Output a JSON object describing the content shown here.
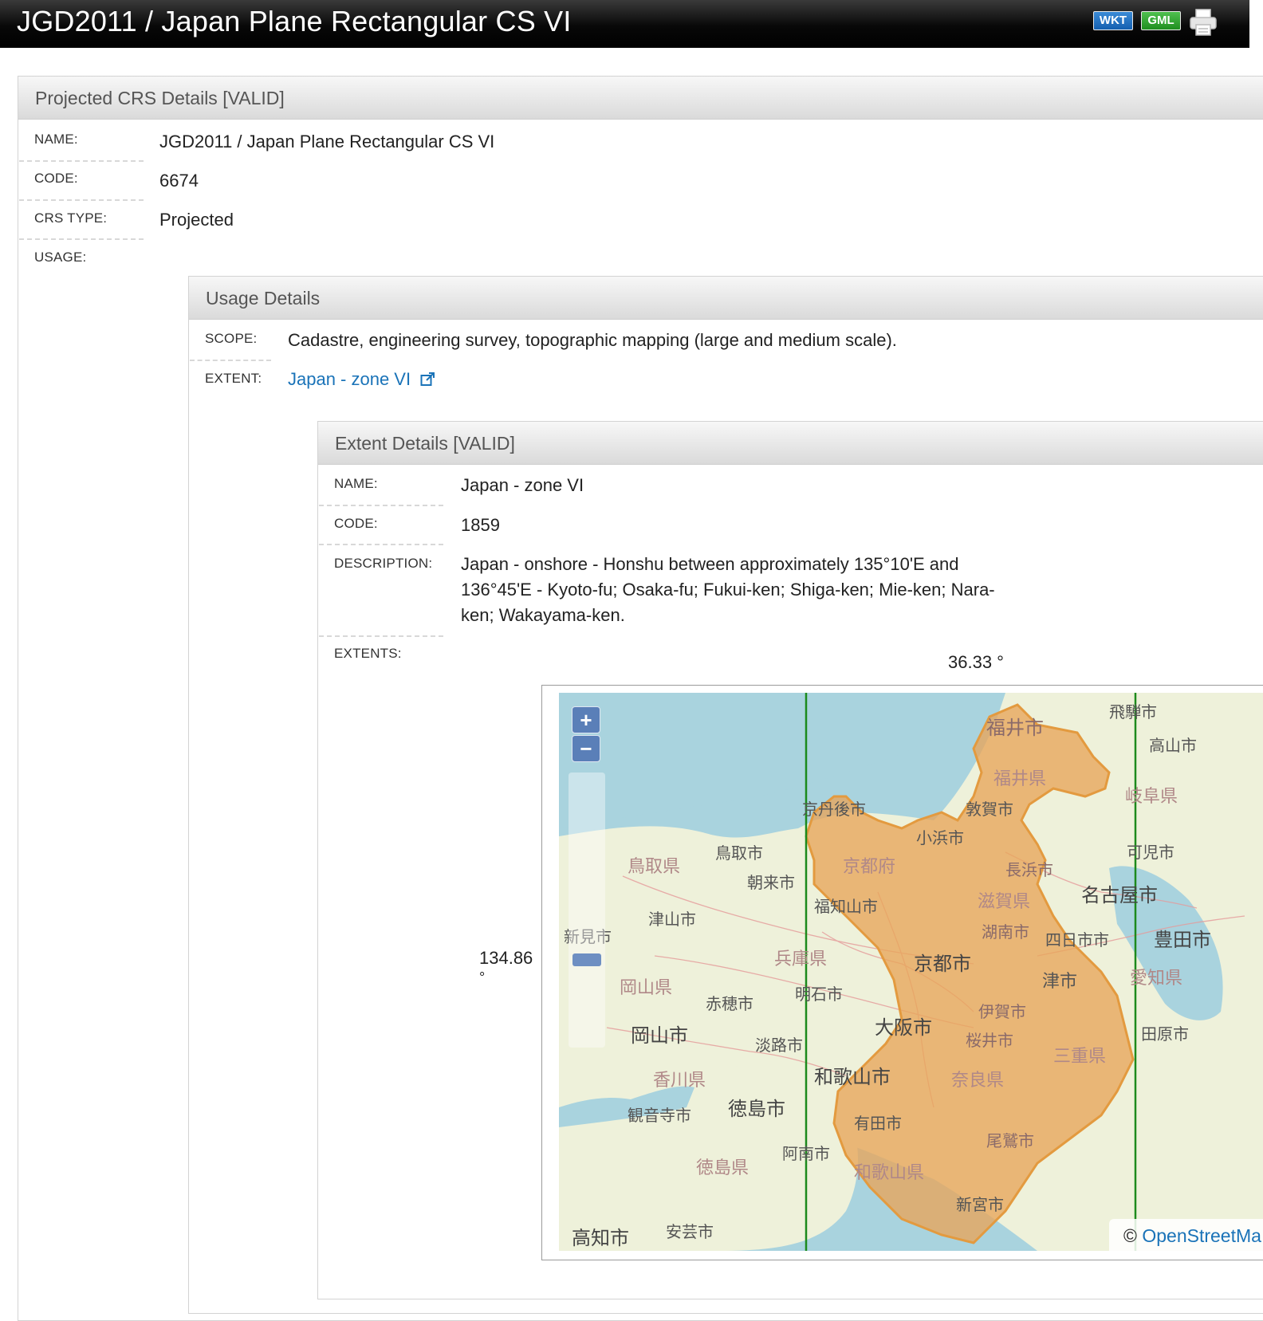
{
  "header": {
    "title": "JGD2011 / Japan Plane Rectangular CS VI",
    "wkt_label": "WKT",
    "gml_label": "GML"
  },
  "crs_panel": {
    "heading": "Projected CRS Details [VALID]",
    "name_label": "NAME:",
    "name_value": "JGD2011 / Japan Plane Rectangular CS VI",
    "code_label": "CODE:",
    "code_value": "6674",
    "type_label": "CRS TYPE:",
    "type_value": "Projected",
    "usage_label": "USAGE:"
  },
  "usage_panel": {
    "heading": "Usage Details",
    "scope_label": "SCOPE:",
    "scope_value": "Cadastre, engineering survey, topographic mapping (large and medium scale).",
    "extent_label": "EXTENT:",
    "extent_link": "Japan - zone VI"
  },
  "extent_panel": {
    "heading": "Extent Details [VALID]",
    "name_label": "NAME:",
    "name_value": "Japan - zone VI",
    "code_label": "CODE:",
    "code_value": "1859",
    "description_label": "DESCRIPTION:",
    "description_value": "Japan - onshore - Honshu between approximately 135°10'E and 136°45'E - Kyoto-fu; Osaka-fu; Fukui-ken; Shiga-ken; Mie-ken; Nara-ken; Wakayama-ken.",
    "extents_label": "EXTENTS:",
    "north_bound": "36.33 °",
    "west_bound": "134.86",
    "west_bound_unit": "°"
  },
  "map": {
    "zoom_in": "+",
    "zoom_out": "−",
    "attribution_symbol": "©",
    "attribution_link": "OpenStreetMa",
    "colors": {
      "water": "#a9d3de",
      "land": "#eaf0d8",
      "region": "#e8a55a",
      "bound": "#1c8a1c"
    },
    "labels": {
      "fukui_shi": "福井市",
      "fukui_ken": "福井県",
      "hida": "飛騨市",
      "takayama": "高山市",
      "gifu_ken": "岐阜県",
      "kyotango": "京丹後市",
      "tsuruga": "敦賀市",
      "obama": "小浜市",
      "kani": "可児市",
      "tottori_ken": "鳥取県",
      "tottori_shi": "鳥取市",
      "asago": "朝来市",
      "kyoto_fu": "京都府",
      "nagahama": "長浜市",
      "nagoya": "名古屋市",
      "fukuchiyama": "福知山市",
      "shiga_ken": "滋賀県",
      "tsuyama": "津山市",
      "konan": "湖南市",
      "yokkaichi": "四日市市",
      "toyota": "豊田市",
      "niimi": "新見市",
      "hyogo_ken": "兵庫県",
      "kyoto_shi": "京都市",
      "tsu": "津市",
      "aichi_ken": "愛知県",
      "okayama_ken": "岡山県",
      "ako": "赤穂市",
      "akashi": "明石市",
      "iga": "伊賀市",
      "okayama_shi": "岡山市",
      "awaji": "淡路市",
      "osaka": "大阪市",
      "sakurai": "桜井市",
      "tahara": "田原市",
      "mie_ken": "三重県",
      "kagawa_ken": "香川県",
      "wakayama_shi": "和歌山市",
      "nara_ken": "奈良県",
      "kanonji": "観音寺市",
      "tokushima_shi": "徳島市",
      "arida": "有田市",
      "anan": "阿南市",
      "owase": "尾鷲市",
      "tokushima_ken": "徳島県",
      "wakayama_ken": "和歌山県",
      "shingu": "新宮市",
      "kochi": "高知市",
      "aki": "安芸市"
    }
  }
}
